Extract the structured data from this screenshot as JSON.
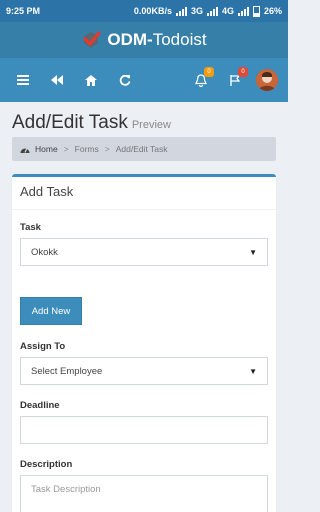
{
  "status_bar": {
    "time": "9:25 PM",
    "speed": "0.00KB/s",
    "network_3g": "3G",
    "network_4g": "4G",
    "battery": "26%"
  },
  "header": {
    "logo_prefix": "ODM-",
    "logo_suffix": "Todoist",
    "notifications_count": "0",
    "flags_count": "0"
  },
  "page": {
    "title": "Add/Edit Task",
    "subtitle": "Preview",
    "breadcrumb": {
      "home": "Home",
      "forms": "Forms",
      "current": "Add/Edit Task"
    }
  },
  "form": {
    "box_title": "Add Task",
    "task_label": "Task",
    "task_value": "Okokk",
    "add_new_label": "Add New",
    "assign_label": "Assign To",
    "assign_value": "Select Employee",
    "deadline_label": "Deadline",
    "deadline_value": "",
    "description_label": "Description",
    "description_placeholder": "Task Description"
  },
  "colors": {
    "status_bar": "#2c73a8",
    "logo_bar": "#367fa9",
    "navbar": "#3c8dbc",
    "page_bg": "#ecf0f5",
    "breadcrumb_bg": "#d2d6de",
    "button_bg": "#3c8dbc"
  }
}
